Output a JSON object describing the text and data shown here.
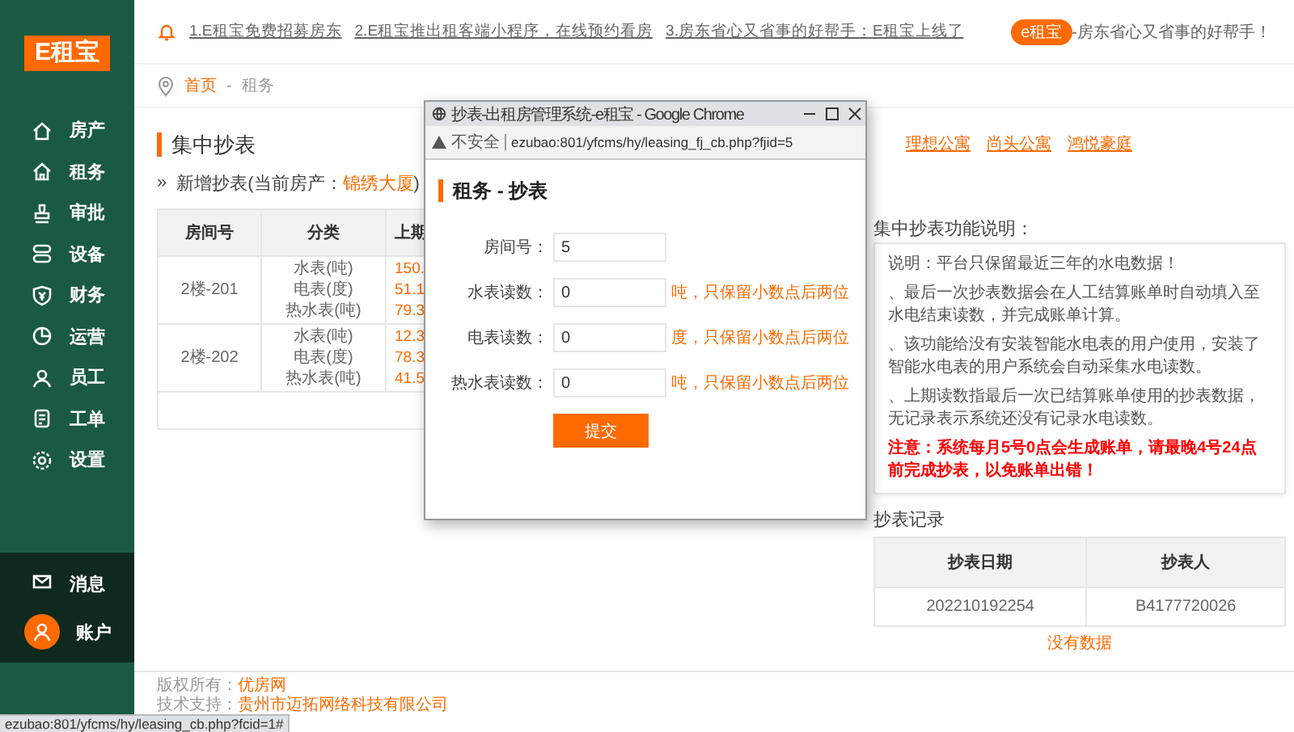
{
  "sidebar": {
    "logo": "E租宝",
    "items": [
      {
        "label": "房产"
      },
      {
        "label": "租务"
      },
      {
        "label": "审批"
      },
      {
        "label": "设备"
      },
      {
        "label": "财务"
      },
      {
        "label": "运营"
      },
      {
        "label": "员工"
      },
      {
        "label": "工单"
      },
      {
        "label": "设置"
      }
    ],
    "bottom_items": [
      {
        "label": "消息"
      },
      {
        "label": "账户"
      }
    ]
  },
  "top_bar": {
    "notices": [
      "1.E租宝免费招募房东",
      "2.E租宝推出租客端小程序，在线预约看房",
      "3.房东省心又省事的好帮手：E租宝上线了"
    ],
    "badge": "e租宝",
    "slogan": "-房东省心又省事的好帮手！"
  },
  "breadcrumb": {
    "items": [
      "首页",
      "租务"
    ],
    "separator": "-"
  },
  "section": {
    "title": "集中抄表",
    "property_links": [
      "理想公寓",
      "尚头公寓",
      "鸿悦豪庭"
    ],
    "subtitle_marker": "»",
    "subtitle": "新增抄表(当前房产：",
    "current_property": "锦绣大厦",
    "subtitle_end": ")"
  },
  "table": {
    "columns": [
      "房间号",
      "分类",
      "上期"
    ],
    "rows": [
      {
        "room": "2楼-201",
        "categories": [
          "水表(吨)",
          "电表(度)",
          "热水表(吨)"
        ],
        "previous": [
          "150.",
          "51.1",
          "79.3"
        ]
      },
      {
        "room": "2楼-202",
        "categories": [
          "水表(吨)",
          "电表(度)",
          "热水表(吨)"
        ],
        "previous": [
          "12.3",
          "78.3",
          "41.5"
        ]
      }
    ]
  },
  "notes": {
    "title": "集中抄表功能说明：",
    "items": [
      {
        "kind": "normal",
        "text": "说明：平台只保留最近三年的水电数据！"
      },
      {
        "kind": "normal",
        "text": "、最后一次抄表数据会在人工结算账单时自动填入至水电结束读数，并完成账单计算。"
      },
      {
        "kind": "normal",
        "text": "、该功能给没有安装智能水电表的用户使用，安装了智能水电表的用户系统会自动采集水电读数。"
      },
      {
        "kind": "normal",
        "text": "、上期读数指最后一次已结算账单使用的抄表数据，无记录表示系统还没有记录水电读数。"
      },
      {
        "kind": "warning",
        "text": "注意：系统每月5号0点会生成账单，请最晚4号24点前完成抄表，以免账单出错！"
      }
    ]
  },
  "records": {
    "title": "抄表记录",
    "columns": [
      "抄表日期",
      "抄表人"
    ],
    "rows": [
      [
        "202210192254",
        "B4177720026"
      ]
    ],
    "empty_text": "没有数据"
  },
  "footer": [
    {
      "label": "版权所有：",
      "value": "优房网"
    },
    {
      "label": "技术支持：",
      "value": "贵州市迈拓网络科技有限公司"
    }
  ],
  "popup": {
    "title": "抄表-出租房管理系统-e租宝 - Google Chrome",
    "security": "不安全",
    "url": "ezubao:801/yfcms/hy/leasing_fj_cb.php?fjid=5",
    "heading": "租务 - 抄表",
    "fields": [
      {
        "label": "房间号：",
        "value": "5"
      },
      {
        "label": "水表读数：",
        "value": "0",
        "hint": "吨，只保留小数点后两位"
      },
      {
        "label": "电表读数：",
        "value": "0",
        "hint": "度，只保留小数点后两位"
      },
      {
        "label": "热水表读数：",
        "value": "0",
        "hint": "吨，只保留小数点后两位"
      }
    ],
    "submit": "提交"
  },
  "status_url": "ezubao:801/yfcms/hy/leasing_cb.php?fcid=1#"
}
